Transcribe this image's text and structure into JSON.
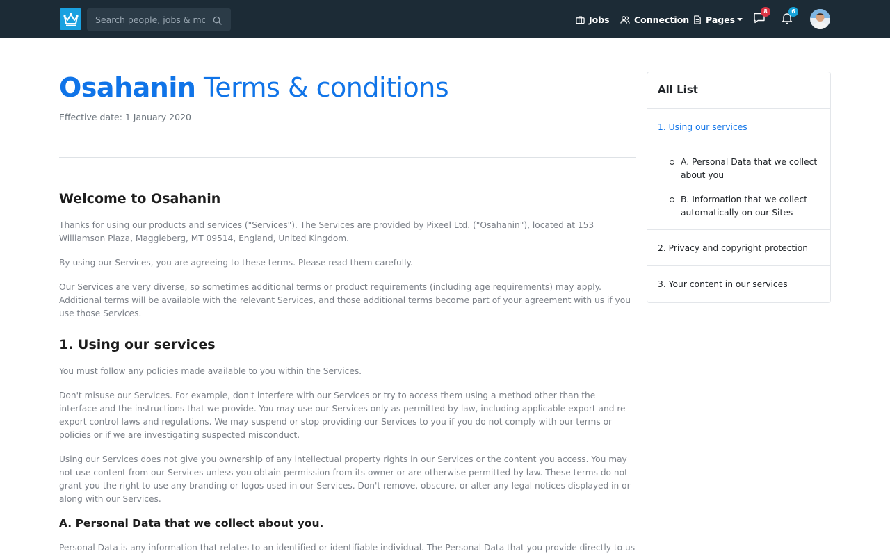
{
  "navbar": {
    "search_placeholder": "Search people, jobs & more...",
    "jobs_label": "Jobs",
    "connection_label": "Connection",
    "pages_label": "Pages",
    "messages_count": "8",
    "notifications_count": "6"
  },
  "header": {
    "brand": "Osahanin",
    "title_rest": " Terms & conditions",
    "effective_date": "Effective date: 1 January 2020"
  },
  "content": {
    "welcome_heading": "Welcome to Osahanin",
    "welcome_p1": "Thanks for using our products and services (\"Services\"). The Services are provided by Pixeel Ltd. (\"Osahanin\"), located at 153 Williamson Plaza, Maggieberg, MT 09514, England, United Kingdom.",
    "welcome_p2": "By using our Services, you are agreeing to these terms. Please read them carefully.",
    "welcome_p3": "Our Services are very diverse, so sometimes additional terms or product requirements (including age requirements) may apply. Additional terms will be available with the relevant Services, and those additional terms become part of your agreement with us if you use those Services.",
    "using_heading": "1. Using our services",
    "using_p1": "You must follow any policies made available to you within the Services.",
    "using_p2": "Don't misuse our Services. For example, don't interfere with our Services or try to access them using a method other than the interface and the instructions that we provide. You may use our Services only as permitted by law, including applicable export and re-export control laws and regulations. We may suspend or stop providing our Services to you if you do not comply with our terms or policies or if we are investigating suspected misconduct.",
    "using_p3": "Using our Services does not give you ownership of any intellectual property rights in our Services or the content you access. You may not use content from our Services unless you obtain permission from its owner or are otherwise permitted by law. These terms do not grant you the right to use any branding or logos used in our Services. Don't remove, obscure, or alter any legal notices displayed in or along with our Services.",
    "personal_heading": "A. Personal Data that we collect about you.",
    "personal_p1": "Personal Data is any information that relates to an identified or identifiable individual. The Personal Data that you provide directly to us"
  },
  "sidebar": {
    "title": "All List",
    "items": [
      {
        "label": "1. Using our services"
      },
      {
        "label": "A. Personal Data that we collect about you"
      },
      {
        "label": "B. Information that we collect automatically on our Sites"
      },
      {
        "label": "2. Privacy and copyright protection"
      },
      {
        "label": "3. Your content in our services"
      }
    ]
  },
  "colors": {
    "navbar_bg": "#1c2b36",
    "accent": "#1074e8",
    "badge_red": "#dc3545",
    "badge_cyan": "#17a2d8"
  },
  "icons": [
    "crown-logo-icon",
    "search-icon",
    "briefcase-icon",
    "users-icon",
    "document-icon",
    "chat-icon",
    "bell-icon"
  ]
}
